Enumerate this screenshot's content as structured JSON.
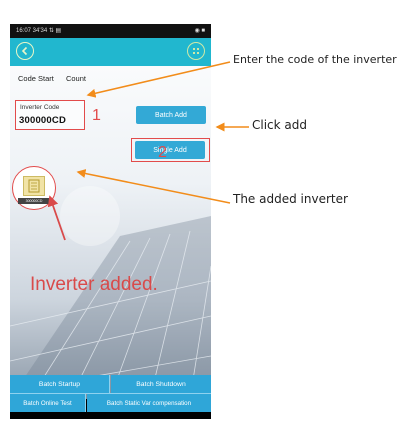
{
  "status_bar": {
    "time": "16:07 34'34 ⇅ ▤",
    "icons": "◉ ■"
  },
  "header": {
    "labels": [
      "Code Start",
      "Count"
    ]
  },
  "code_field": {
    "label": "Inverter Code",
    "value": "300000CD"
  },
  "buttons": {
    "batch_add": "Batch Add",
    "single_add": "Single Add"
  },
  "inverter": {
    "caption": "300000CD"
  },
  "bottom_buttons": {
    "batch_startup": "Batch Startup",
    "batch_shutdown": "Batch Shutdown",
    "batch_online_test": "Batch Online Test",
    "batch_static_var": "Batch Static Var compensation"
  },
  "annotations": {
    "enter_code": "Enter the code of the inverter",
    "click_add": "Click add",
    "added_inverter": "The added inverter",
    "inverter_added": "Inverter added.",
    "step_1": "1",
    "step_2": "2"
  },
  "colors": {
    "accent": "#21b7cf",
    "button": "#33a9d6",
    "annotation_red": "#e24b4b",
    "arrow": "#f28c1a"
  }
}
